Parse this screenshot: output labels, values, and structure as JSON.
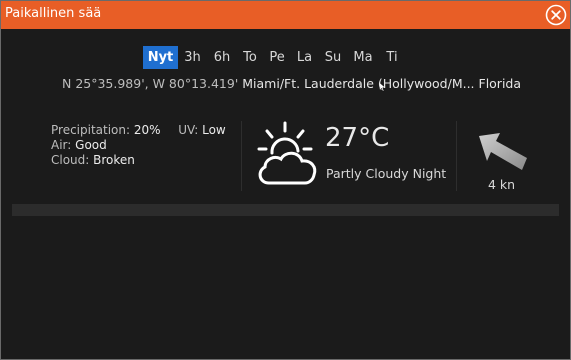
{
  "window": {
    "title": "Paikallinen sää",
    "accent_color": "#e85e26",
    "close_icon": "close-circle-x-icon"
  },
  "tabs": [
    {
      "label": "Nyt",
      "active": true
    },
    {
      "label": "3h",
      "active": false
    },
    {
      "label": "6h",
      "active": false
    },
    {
      "label": "To",
      "active": false
    },
    {
      "label": "Pe",
      "active": false
    },
    {
      "label": "La",
      "active": false
    },
    {
      "label": "Su",
      "active": false
    },
    {
      "label": "Ma",
      "active": false
    },
    {
      "label": "Ti",
      "active": false
    }
  ],
  "location": {
    "coordinates": "N  25°35.989', W  80°13.419'",
    "place": "Miami/Ft. Lauderdale (Hollywood/M... Florida"
  },
  "details": {
    "precipitation_label": "Precipitation:",
    "precipitation_value": "20%",
    "uv_label": "UV:",
    "uv_value": "Low",
    "air_label": "Air:",
    "air_value": "Good",
    "cloud_label": "Cloud:",
    "cloud_value": "Broken"
  },
  "current": {
    "icon": "partly-cloudy-night-icon",
    "temperature": "27°C",
    "condition": "Partly Cloudy Night"
  },
  "wind": {
    "icon": "wind-direction-arrow-icon",
    "speed": "4 kn"
  },
  "colors": {
    "tab_active": "#1f6fd0",
    "background": "#1b1b1b"
  }
}
